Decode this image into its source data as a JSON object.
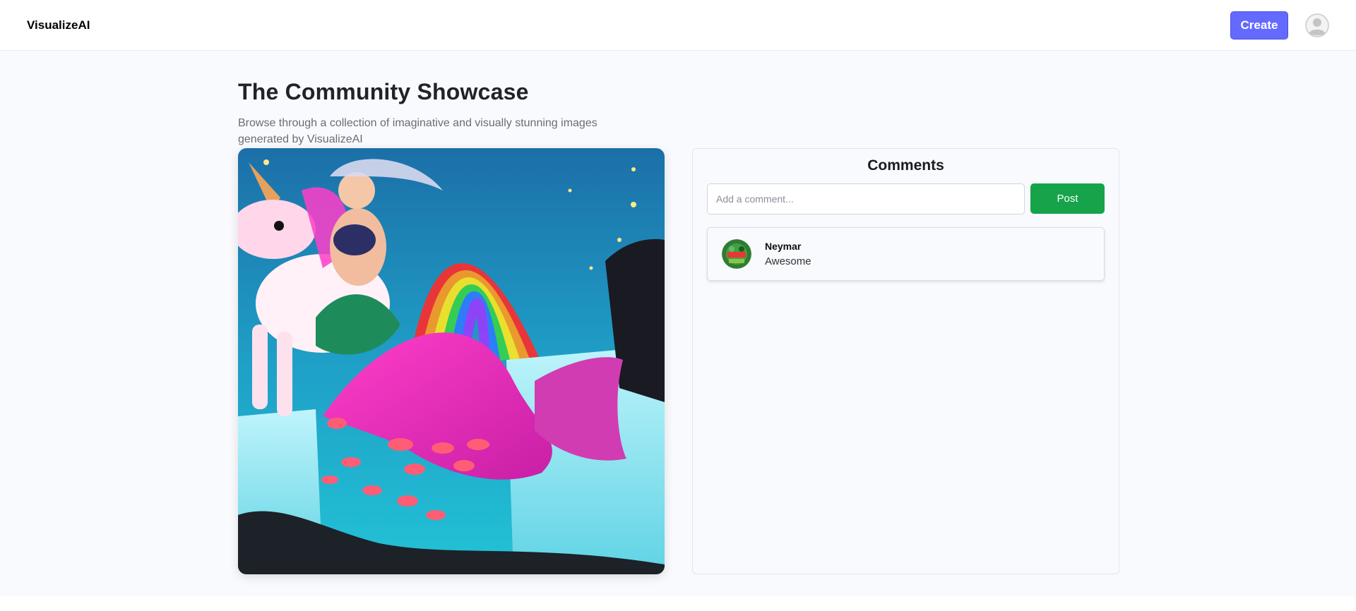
{
  "header": {
    "logo": "VisualizeAI",
    "create_label": "Create",
    "avatar_icon": "user-avatar-icon"
  },
  "showcase": {
    "title": "The Community Showcase",
    "subtitle": "Browse through a collection of imaginative and visually stunning images generated by VisualizeAI"
  },
  "comments": {
    "title": "Comments",
    "input_placeholder": "Add a comment...",
    "input_value": "",
    "post_label": "Post",
    "items": [
      {
        "author": "Neymar",
        "text": "Awesome"
      }
    ]
  },
  "colors": {
    "accent": "#6469ff",
    "post_button": "#16a34a",
    "page_background": "#f9fafe"
  }
}
